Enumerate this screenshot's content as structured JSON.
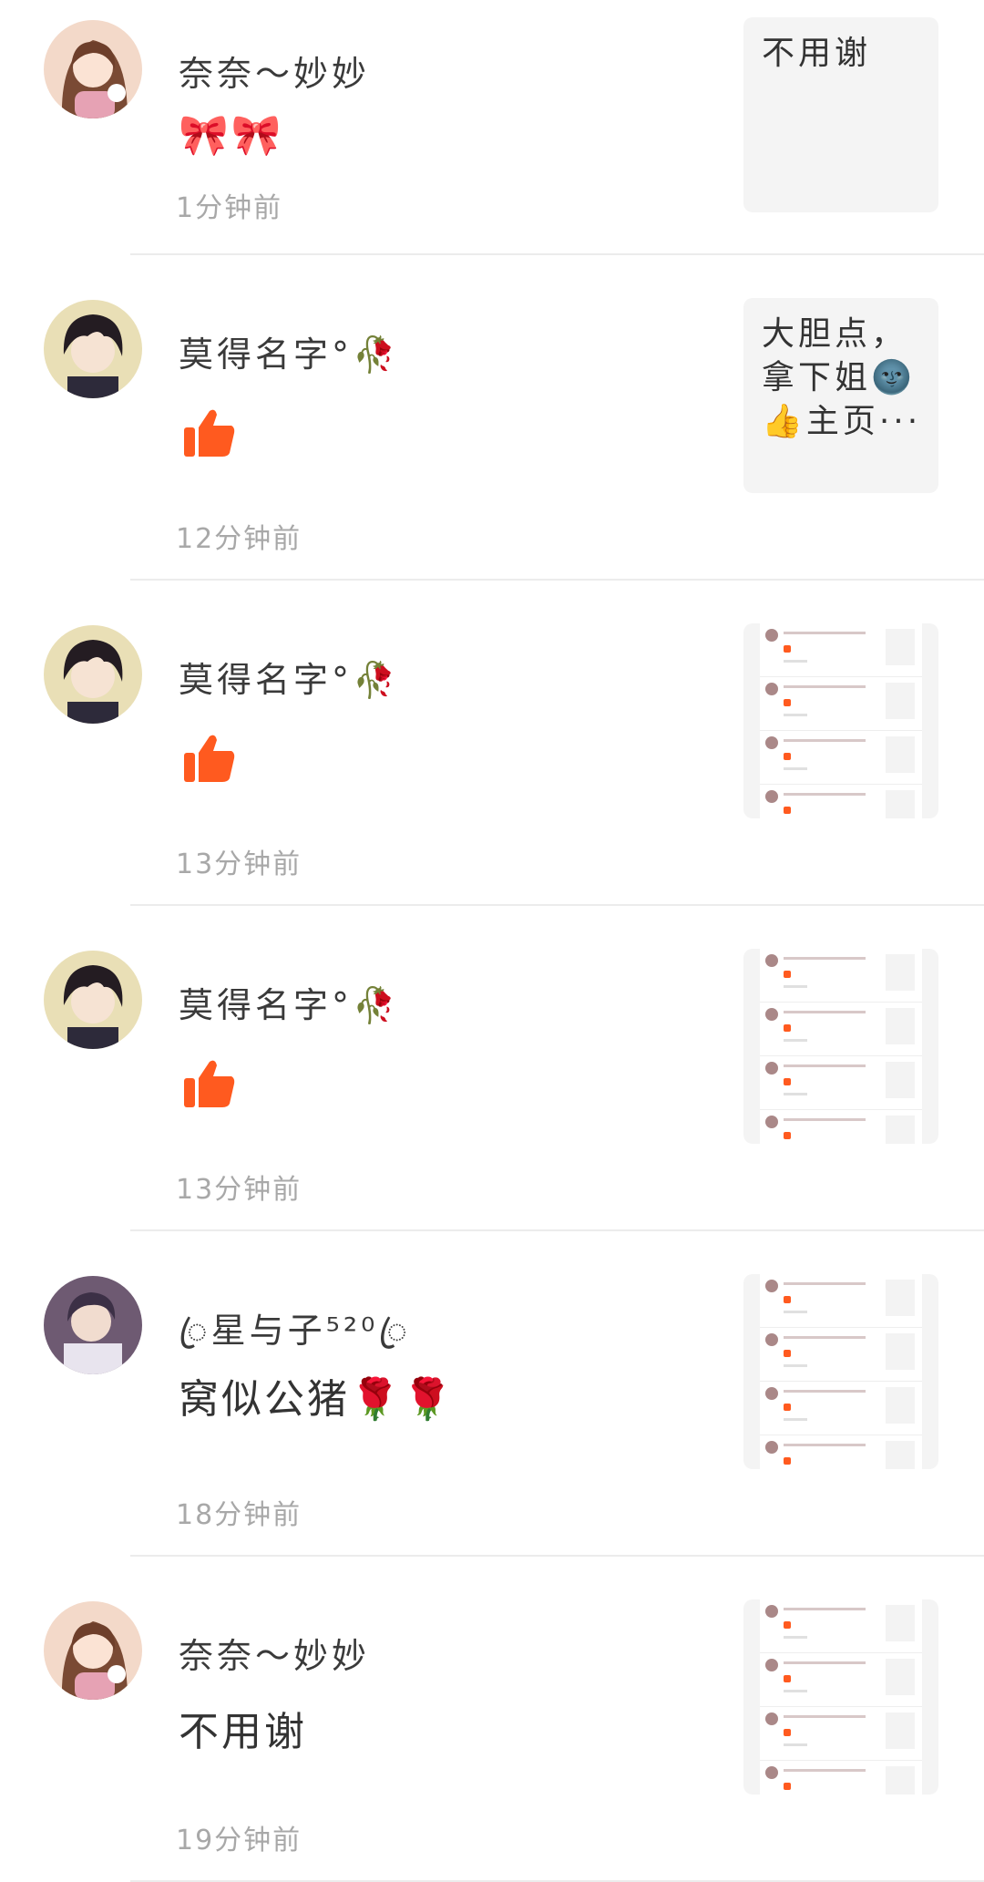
{
  "notifications": [
    {
      "name": "奈奈～妙妙",
      "content": "🎀🎀",
      "time": "1分钟前",
      "thumb_type": "text",
      "thumb_text": "不用谢",
      "avatar": "girl-avatar"
    },
    {
      "name": "莫得名字°🥀",
      "content": "",
      "time": "12分钟前",
      "thumb_type": "text",
      "thumb_text": "大胆点，拿下姐🌚👍主页···",
      "avatar": "boy-avatar"
    },
    {
      "name": "莫得名字°🥀",
      "content": "",
      "time": "13分钟前",
      "thumb_type": "image",
      "avatar": "boy-avatar"
    },
    {
      "name": "莫得名字°🥀",
      "content": "",
      "time": "13分钟前",
      "thumb_type": "image",
      "avatar": "boy-avatar"
    },
    {
      "name": "ꦿ星与子⁵²⁰ꦿ",
      "content": "窝似公猪🌹🌹",
      "time": "18分钟前",
      "thumb_type": "image",
      "avatar": "boy2-avatar"
    },
    {
      "name": "奈奈～妙妙",
      "content": "不用谢",
      "time": "19分钟前",
      "thumb_type": "image",
      "avatar": "girl-avatar"
    }
  ],
  "colors": {
    "like": "#ff5a1f",
    "time": "#a8a8a8",
    "divider": "#ececec",
    "thumb_bg": "#f4f4f4"
  }
}
